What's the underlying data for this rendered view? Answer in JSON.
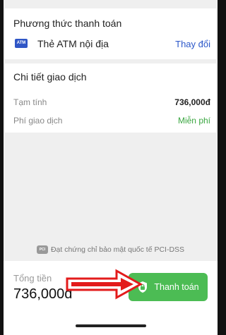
{
  "payment_card": {
    "title": "Phương thức thanh toán",
    "method_icon": "atm-card-icon",
    "method_icon_text": "ATM",
    "method_label": "Thẻ ATM nội địa",
    "change_label": "Thay đổi"
  },
  "detail_card": {
    "title": "Chi tiết giao dịch",
    "rows": [
      {
        "label": "Tạm tính",
        "value": "736,000đ"
      },
      {
        "label": "Phí giao dịch",
        "value": "Miễn phí"
      }
    ]
  },
  "security_note": {
    "icon": "pci-icon",
    "text": "Đạt chứng chỉ bảo mật quốc tế PCI-DSS"
  },
  "footer": {
    "total_label": "Tổng tiền",
    "total_value": "736,000đ",
    "pay_button_label": "Thanh toán"
  },
  "colors": {
    "accent_blue": "#2b57c9",
    "success_green": "#4cbc54",
    "annotation_red": "#e31b1b"
  }
}
